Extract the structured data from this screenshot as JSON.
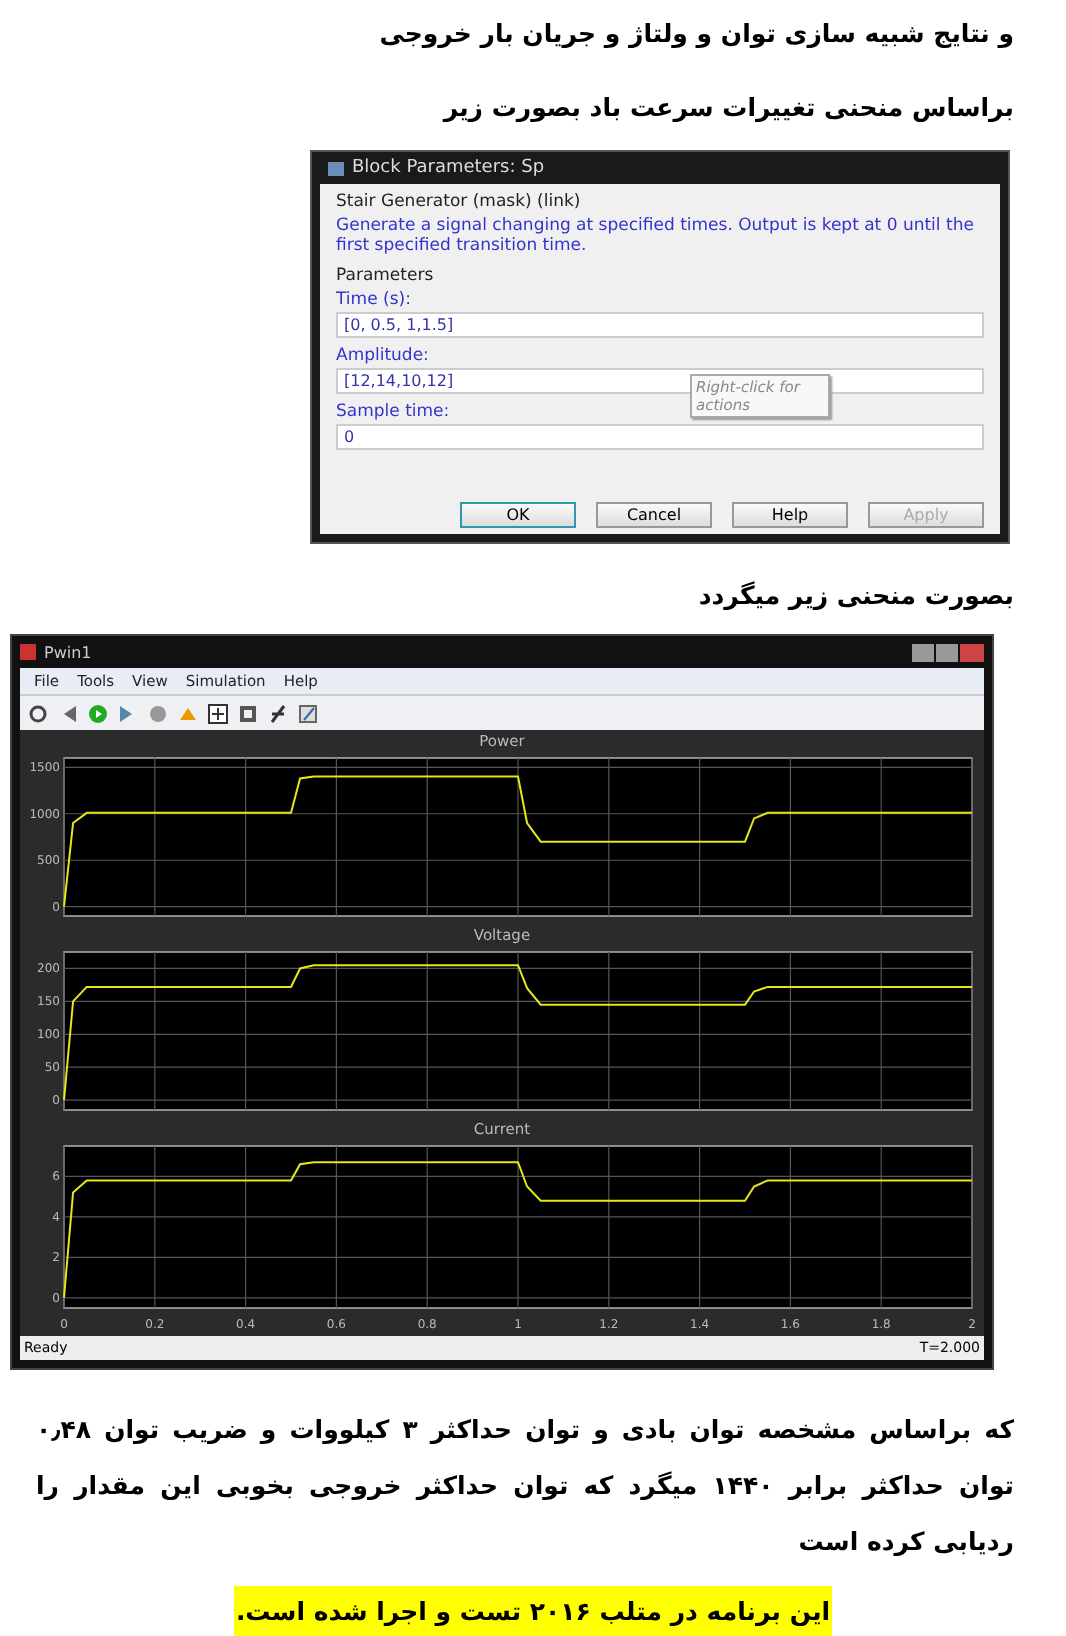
{
  "heading_lines": [
    "و نتایج شبیه سازی توان و ولتاژ و جریان بار خروجی",
    "براساس منحنی تغییرات سرعت باد بصورت زیر"
  ],
  "dialog": {
    "title": "Block Parameters: Sp",
    "block_name": "Stair Generator (mask) (link)",
    "description": "Generate a signal changing at specified times. Output is kept at 0 until the first specified transition time.",
    "section": "Parameters",
    "fields": [
      {
        "label": "Time (s):",
        "value": "[0, 0.5, 1,1.5]"
      },
      {
        "label": "Amplitude:",
        "value": "[12,14,10,12]"
      },
      {
        "label": "Sample time:",
        "value": "0"
      }
    ],
    "tooltip": "Right-click for actions",
    "buttons": [
      {
        "label": "OK",
        "disabled": false,
        "default": true
      },
      {
        "label": "Cancel",
        "disabled": false,
        "default": false
      },
      {
        "label": "Help",
        "disabled": false,
        "default": false
      },
      {
        "label": "Apply",
        "disabled": true,
        "default": false
      }
    ]
  },
  "caption": "بصورت منحنی زیر میگردد",
  "scope": {
    "title": "Pwin1",
    "menu": [
      "File",
      "Tools",
      "View",
      "Simulation",
      "Help"
    ],
    "plots": [
      {
        "chart_data": {
          "type": "line",
          "title": "Power",
          "grid": true,
          "x": [
            0,
            0.02,
            0.05,
            0.5,
            0.52,
            0.55,
            1.0,
            1.02,
            1.05,
            1.5,
            1.52,
            1.55,
            2.0
          ],
          "series": [
            {
              "color": "#e6e619",
              "values": [
                0,
                900,
                1010,
                1010,
                1380,
                1400,
                1400,
                900,
                700,
                700,
                950,
                1010,
                1010
              ]
            }
          ],
          "xlim": [
            0,
            2
          ],
          "ylim": [
            -100,
            1600
          ],
          "yticks": [
            0,
            500,
            1000,
            1500
          ]
        }
      },
      {
        "chart_data": {
          "type": "line",
          "title": "Voltage",
          "grid": true,
          "x": [
            0,
            0.02,
            0.05,
            0.5,
            0.52,
            0.55,
            1.0,
            1.02,
            1.05,
            1.5,
            1.52,
            1.55,
            2.0
          ],
          "series": [
            {
              "color": "#e6e619",
              "values": [
                0,
                150,
                172,
                172,
                200,
                205,
                205,
                170,
                145,
                145,
                165,
                172,
                172
              ]
            }
          ],
          "xlim": [
            0,
            2
          ],
          "ylim": [
            -15,
            225
          ],
          "yticks": [
            0,
            50,
            100,
            150,
            200
          ]
        }
      },
      {
        "chart_data": {
          "type": "line",
          "title": "Current",
          "grid": true,
          "x": [
            0,
            0.02,
            0.05,
            0.5,
            0.52,
            0.55,
            1.0,
            1.02,
            1.05,
            1.5,
            1.52,
            1.55,
            2.0
          ],
          "series": [
            {
              "color": "#e6e619",
              "values": [
                0,
                5.2,
                5.8,
                5.8,
                6.6,
                6.7,
                6.7,
                5.5,
                4.8,
                4.8,
                5.5,
                5.8,
                5.8
              ]
            }
          ],
          "xlim": [
            0,
            2
          ],
          "ylim": [
            -0.5,
            7.5
          ],
          "xticks": [
            0,
            0.2,
            0.4,
            0.6,
            0.8,
            1,
            1.2,
            1.4,
            1.6,
            1.8,
            2
          ],
          "yticks": [
            0,
            2,
            4,
            6
          ]
        }
      }
    ],
    "status": "Ready",
    "time": "T=2.000"
  },
  "paragraph": "که براساس مشخصه توان بادی و توان حداکثر ۳ کیلووات و ضریب توان ۰٫۴۸ توان حداکثر برابر ۱۴۴۰ میگرد که توان حداکثر خروجی بخوبی این مقدار را ردیابی کرده است",
  "highlight": "این برنامه در متلب ۲۰۱۶ تست و اجرا شده است."
}
